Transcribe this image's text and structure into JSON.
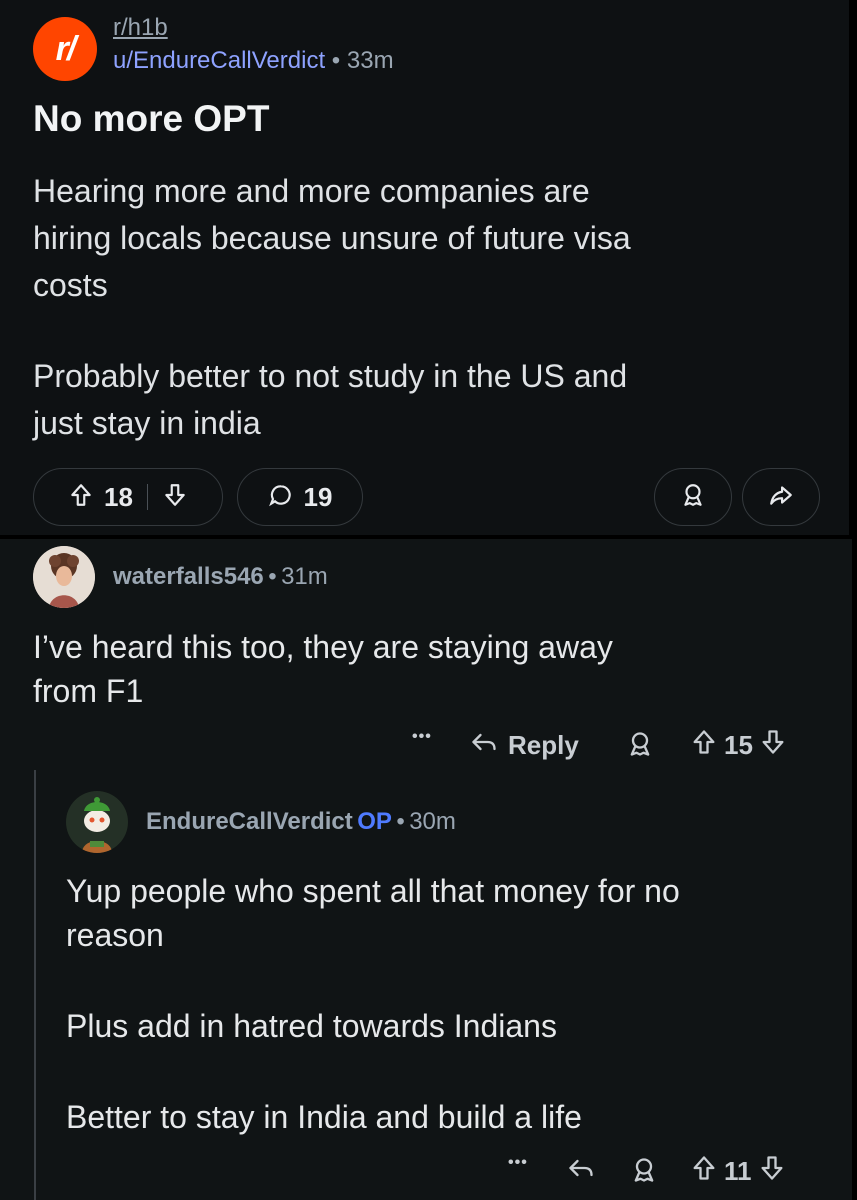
{
  "post": {
    "subreddit_logo": "r/",
    "subreddit": "r/h1b",
    "author": "u/EndureCallVerdict",
    "separator": "•",
    "time": "33m",
    "title": "No more OPT",
    "body_lines": [
      "Hearing more and more companies are",
      "hiring locals because unsure of future visa",
      "costs",
      "Probably better to not study in the US and",
      "just stay in india"
    ],
    "upvotes": "18",
    "comments": "19",
    "icons": [
      "upvote-icon",
      "downvote-icon",
      "comment-icon",
      "award-icon",
      "share-icon"
    ]
  },
  "comments": [
    {
      "user": "waterfalls546",
      "separator": "•",
      "time": "31m",
      "lines": [
        "I’ve heard this too, they are staying away",
        "from F1"
      ],
      "more": "•••",
      "reply_label": "Reply",
      "score": "15"
    },
    {
      "user": "EndureCallVerdict",
      "op_badge": "OP",
      "separator": "•",
      "time": "30m",
      "lines": [
        "Yup people who spent all that money for no",
        "reason",
        "Plus add in hatred towards Indians",
        "Better to stay in India and build a life"
      ],
      "more": "•••",
      "score": "11"
    }
  ],
  "colors": {
    "background": "#0e1113",
    "accent": "#ff4500",
    "link": "#8ea2ff",
    "op": "#4f7bff"
  }
}
